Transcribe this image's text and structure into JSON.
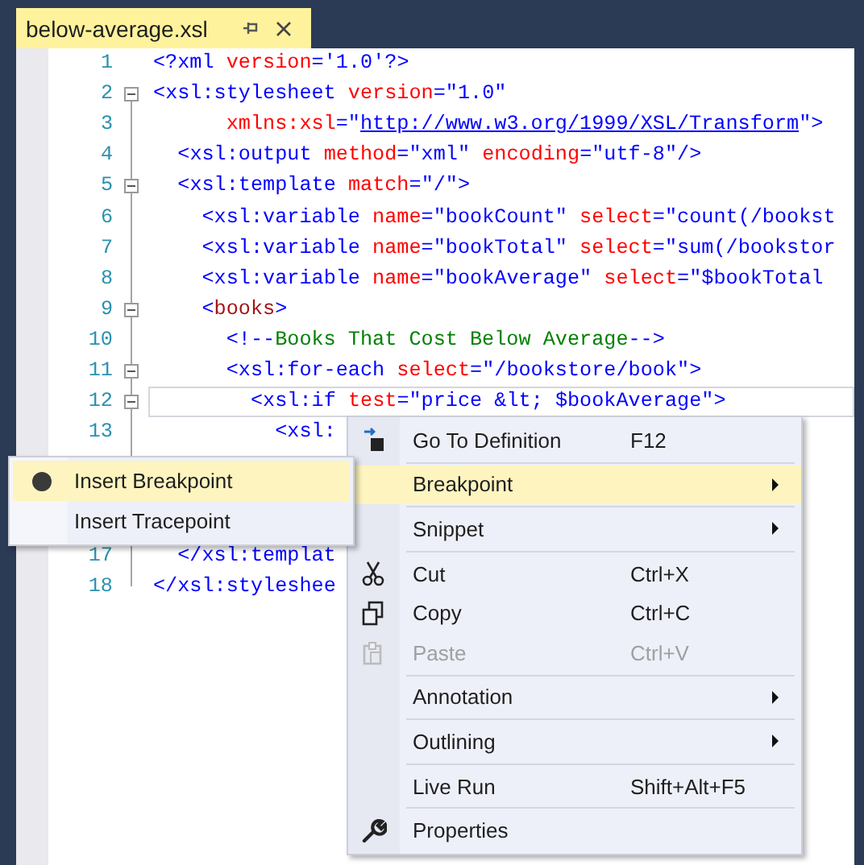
{
  "tab": {
    "title": "below-average.xsl"
  },
  "lines": [
    {
      "number": "1",
      "fold": false,
      "current": false,
      "tokens": [
        {
          "kind": "delim",
          "text": "<?"
        },
        {
          "kind": "name",
          "text": "xml"
        },
        {
          "kind": "attr",
          "text": " version"
        },
        {
          "kind": "delim",
          "text": "="
        },
        {
          "kind": "value",
          "text": "'1.0'"
        },
        {
          "kind": "delim",
          "text": "?>"
        }
      ]
    },
    {
      "number": "2",
      "fold": true,
      "current": false,
      "tokens": [
        {
          "kind": "delim",
          "text": "<"
        },
        {
          "kind": "name",
          "text": "xsl:stylesheet"
        },
        {
          "kind": "attr",
          "text": " version"
        },
        {
          "kind": "delim",
          "text": "="
        },
        {
          "kind": "value",
          "text": "\"1.0\""
        }
      ]
    },
    {
      "number": "3",
      "fold": false,
      "current": false,
      "tokens": [
        {
          "kind": "attr",
          "text": "      xmlns:xsl"
        },
        {
          "kind": "delim",
          "text": "=\""
        },
        {
          "kind": "link",
          "text": "http://www.w3.org/1999/XSL/Transform"
        },
        {
          "kind": "delim",
          "text": "\">"
        }
      ]
    },
    {
      "number": "4",
      "fold": false,
      "current": false,
      "tokens": [
        {
          "kind": "delim",
          "text": "  <"
        },
        {
          "kind": "name",
          "text": "xsl:output"
        },
        {
          "kind": "attr",
          "text": " method"
        },
        {
          "kind": "delim",
          "text": "="
        },
        {
          "kind": "value",
          "text": "\"xml\""
        },
        {
          "kind": "attr",
          "text": " encoding"
        },
        {
          "kind": "delim",
          "text": "="
        },
        {
          "kind": "value",
          "text": "\"utf-8\""
        },
        {
          "kind": "delim",
          "text": "/>"
        }
      ]
    },
    {
      "number": "5",
      "fold": true,
      "current": false,
      "tokens": [
        {
          "kind": "delim",
          "text": "  <"
        },
        {
          "kind": "name",
          "text": "xsl:template"
        },
        {
          "kind": "attr",
          "text": " match"
        },
        {
          "kind": "delim",
          "text": "="
        },
        {
          "kind": "value",
          "text": "\"/\""
        },
        {
          "kind": "delim",
          "text": ">"
        }
      ]
    },
    {
      "number": "6",
      "fold": false,
      "current": false,
      "tokens": [
        {
          "kind": "delim",
          "text": "    <"
        },
        {
          "kind": "name",
          "text": "xsl:variable"
        },
        {
          "kind": "attr",
          "text": " name"
        },
        {
          "kind": "delim",
          "text": "="
        },
        {
          "kind": "value",
          "text": "\"bookCount\""
        },
        {
          "kind": "attr",
          "text": " select"
        },
        {
          "kind": "delim",
          "text": "="
        },
        {
          "kind": "value",
          "text": "\"count(/bookst"
        }
      ]
    },
    {
      "number": "7",
      "fold": false,
      "current": false,
      "tokens": [
        {
          "kind": "delim",
          "text": "    <"
        },
        {
          "kind": "name",
          "text": "xsl:variable"
        },
        {
          "kind": "attr",
          "text": " name"
        },
        {
          "kind": "delim",
          "text": "="
        },
        {
          "kind": "value",
          "text": "\"bookTotal\""
        },
        {
          "kind": "attr",
          "text": " select"
        },
        {
          "kind": "delim",
          "text": "="
        },
        {
          "kind": "value",
          "text": "\"sum(/bookstor"
        }
      ]
    },
    {
      "number": "8",
      "fold": false,
      "current": false,
      "tokens": [
        {
          "kind": "delim",
          "text": "    <"
        },
        {
          "kind": "name",
          "text": "xsl:variable"
        },
        {
          "kind": "attr",
          "text": " name"
        },
        {
          "kind": "delim",
          "text": "="
        },
        {
          "kind": "value",
          "text": "\"bookAverage\""
        },
        {
          "kind": "attr",
          "text": " select"
        },
        {
          "kind": "delim",
          "text": "="
        },
        {
          "kind": "value",
          "text": "\"$bookTotal"
        }
      ]
    },
    {
      "number": "9",
      "fold": true,
      "current": false,
      "tokens": [
        {
          "kind": "delim",
          "text": "    <"
        },
        {
          "kind": "element",
          "text": "books"
        },
        {
          "kind": "delim",
          "text": ">"
        }
      ]
    },
    {
      "number": "10",
      "fold": false,
      "current": false,
      "tokens": [
        {
          "kind": "delim",
          "text": "      <!--"
        },
        {
          "kind": "comment",
          "text": "Books That Cost Below Average"
        },
        {
          "kind": "delim",
          "text": "-->"
        }
      ]
    },
    {
      "number": "11",
      "fold": true,
      "current": false,
      "tokens": [
        {
          "kind": "delim",
          "text": "      <"
        },
        {
          "kind": "name",
          "text": "xsl:for-each"
        },
        {
          "kind": "attr",
          "text": " select"
        },
        {
          "kind": "delim",
          "text": "="
        },
        {
          "kind": "value",
          "text": "\"/bookstore/book\""
        },
        {
          "kind": "delim",
          "text": ">"
        }
      ]
    },
    {
      "number": "12",
      "fold": true,
      "current": true,
      "tokens": [
        {
          "kind": "delim",
          "text": "        <"
        },
        {
          "kind": "name",
          "text": "xsl:if"
        },
        {
          "kind": "attr",
          "text": " test"
        },
        {
          "kind": "delim",
          "text": "="
        },
        {
          "kind": "value",
          "text": "\"price &lt; $bookAverage\""
        },
        {
          "kind": "delim",
          "text": ">"
        }
      ]
    },
    {
      "number": "13",
      "fold": false,
      "current": false,
      "tokens": [
        {
          "kind": "delim",
          "text": "          <"
        },
        {
          "kind": "name",
          "text": "xsl:"
        }
      ]
    },
    {
      "number": "17",
      "fold": false,
      "current": false,
      "tokens": [
        {
          "kind": "delim",
          "text": "  </"
        },
        {
          "kind": "name",
          "text": "xsl:templat"
        }
      ]
    },
    {
      "number": "18",
      "fold": false,
      "current": false,
      "tokens": [
        {
          "kind": "delim",
          "text": "</"
        },
        {
          "kind": "name",
          "text": "xsl:styleshee"
        }
      ]
    }
  ],
  "context_menu": {
    "items": [
      {
        "kind": "command",
        "label": "Go To Definition",
        "shortcut": "F12",
        "selected": false,
        "disabled": false
      },
      {
        "kind": "separator"
      },
      {
        "kind": "submenu",
        "label": "Breakpoint",
        "selected": true,
        "disabled": false
      },
      {
        "kind": "separator"
      },
      {
        "kind": "submenu",
        "label": "Snippet",
        "selected": false,
        "disabled": false
      },
      {
        "kind": "separator"
      },
      {
        "kind": "command",
        "label": "Cut",
        "shortcut": "Ctrl+X",
        "selected": false,
        "disabled": false
      },
      {
        "kind": "command",
        "label": "Copy",
        "shortcut": "Ctrl+C",
        "selected": false,
        "disabled": false
      },
      {
        "kind": "command",
        "label": "Paste",
        "shortcut": "Ctrl+V",
        "selected": false,
        "disabled": true
      },
      {
        "kind": "separator"
      },
      {
        "kind": "submenu",
        "label": "Annotation",
        "selected": false,
        "disabled": false
      },
      {
        "kind": "separator"
      },
      {
        "kind": "submenu",
        "label": "Outlining",
        "selected": false,
        "disabled": false
      },
      {
        "kind": "separator"
      },
      {
        "kind": "command",
        "label": "Live Run",
        "shortcut": "Shift+Alt+F5",
        "selected": false,
        "disabled": false
      },
      {
        "kind": "separator"
      },
      {
        "kind": "command",
        "label": "Properties",
        "selected": false,
        "disabled": false
      }
    ]
  },
  "breakpoint_submenu": {
    "items": [
      {
        "label": "Insert Breakpoint",
        "selected": true
      },
      {
        "label": "Insert Tracepoint",
        "selected": false
      }
    ]
  }
}
